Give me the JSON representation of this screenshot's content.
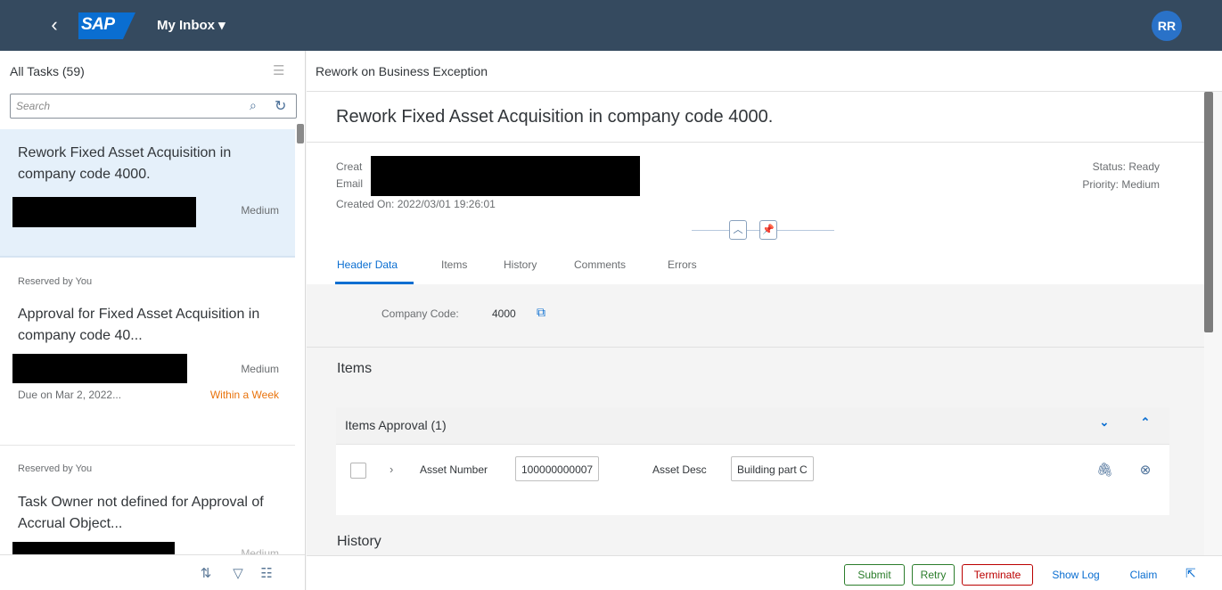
{
  "shell": {
    "back_glyph": "‹",
    "logo_text": "SAP",
    "title": "My Inbox ▾",
    "avatar": "RR"
  },
  "master": {
    "count_label": "All Tasks (59)",
    "search_placeholder": "Search",
    "items": [
      {
        "title": "Rework Fixed Asset Acquisition in company code 4000.",
        "priority": "Medium"
      },
      {
        "reserved": "Reserved by You",
        "title": "Approval for Fixed Asset Acquisition in company code 40...",
        "priority": "Medium",
        "due": "Due on Mar 2, 2022...",
        "due_status": "Within a Week"
      },
      {
        "reserved": "Reserved by You",
        "title": "Task Owner not defined for Approval of Accrual Object...",
        "priority": "Medium"
      }
    ]
  },
  "detail": {
    "header": "Rework on Business Exception",
    "title": "Rework Fixed Asset Acquisition in company code 4000.",
    "created_by_label": "Creat",
    "email_label": "Email",
    "created_on": "Created On: 2022/03/01 19:26:01",
    "status": "Status: Ready",
    "priority": "Priority: Medium",
    "tabs": [
      "Header Data",
      "Items",
      "History",
      "Comments",
      "Errors"
    ],
    "company_code_label": "Company Code:",
    "company_code_value": "4000",
    "items_section": "Items",
    "items_approval": "Items Approval (1)",
    "row": {
      "asset_number_label": "Asset Number",
      "asset_number_value": "100000000007",
      "asset_desc_label": "Asset Desc",
      "asset_desc_value": "Building part C"
    },
    "history_section": "History"
  },
  "footer": {
    "submit": "Submit",
    "retry": "Retry",
    "terminate": "Terminate",
    "show_log": "Show Log",
    "claim": "Claim"
  }
}
